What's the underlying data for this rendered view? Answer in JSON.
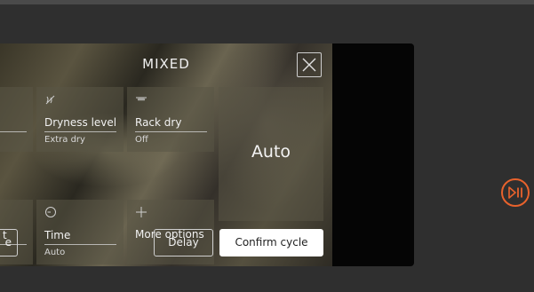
{
  "dialog": {
    "title": "MIXED",
    "close_icon": "close-icon"
  },
  "tiles": {
    "dryness": {
      "label": "Dryness level",
      "value": "Extra dry",
      "icon": "dryness-icon"
    },
    "rack": {
      "label": "Rack dry",
      "value": "Off",
      "icon": "rack-icon"
    },
    "time": {
      "label": "Time",
      "value": "Auto",
      "icon": "clock-icon"
    },
    "more": {
      "label": "More options",
      "icon": "plus-icon"
    },
    "partial_left_bottom": {
      "label_fragment": "t"
    }
  },
  "auto_tile": {
    "label": "Auto"
  },
  "actions": {
    "partial_left_label": "e",
    "delay_label": "Delay",
    "confirm_label": "Confirm cycle"
  },
  "side": {
    "play_pause_icon": "play-pause-icon"
  },
  "colors": {
    "accent": "#e8622c",
    "background": "#2f2f2f",
    "panel": "#050505"
  }
}
